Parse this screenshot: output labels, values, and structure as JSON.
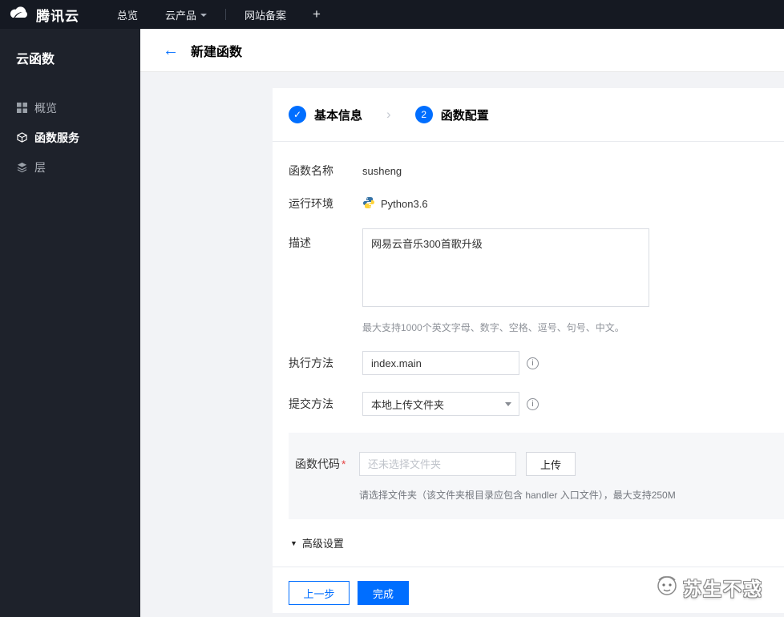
{
  "colors": {
    "accent": "#006eff",
    "topbar_bg": "#151922",
    "sidebar_bg": "#1e222b"
  },
  "icons": {
    "back_arrow": "←",
    "step_check": "✓",
    "step_chevron": "›",
    "advanced_caret": "▼",
    "info": "i",
    "plus": "+"
  },
  "topbar": {
    "brand": "腾讯云",
    "nav": [
      {
        "label": "总览"
      },
      {
        "label": "云产品"
      },
      {
        "label": "网站备案"
      }
    ]
  },
  "sidebar": {
    "title": "云函数",
    "items": [
      {
        "label": "概览"
      },
      {
        "label": "函数服务"
      },
      {
        "label": "层"
      }
    ]
  },
  "page": {
    "title": "新建函数"
  },
  "steps": {
    "step1_label": "基本信息",
    "step2_num": "2",
    "step2_label": "函数配置"
  },
  "form": {
    "name_label": "函数名称",
    "name_value": "susheng",
    "runtime_label": "运行环境",
    "runtime_value": "Python3.6",
    "desc_label": "描述",
    "desc_value": "网易云音乐300首歌升级",
    "desc_help": "最大支持1000个英文字母、数字、空格、逗号、句号、中文。",
    "handler_label": "执行方法",
    "handler_value": "index.main",
    "submit_label": "提交方法",
    "submit_value": "本地上传文件夹",
    "code_label": "函数代码",
    "code_required": "*",
    "code_placeholder": "还未选择文件夹",
    "upload_button": "上传",
    "code_help": "请选择文件夹（该文件夹根目录应包含 handler 入口文件），最大支持250M",
    "advanced_label": "高级设置"
  },
  "footer": {
    "prev_button": "上一步",
    "done_button": "完成"
  },
  "watermark": {
    "text": "苏生不惑"
  }
}
